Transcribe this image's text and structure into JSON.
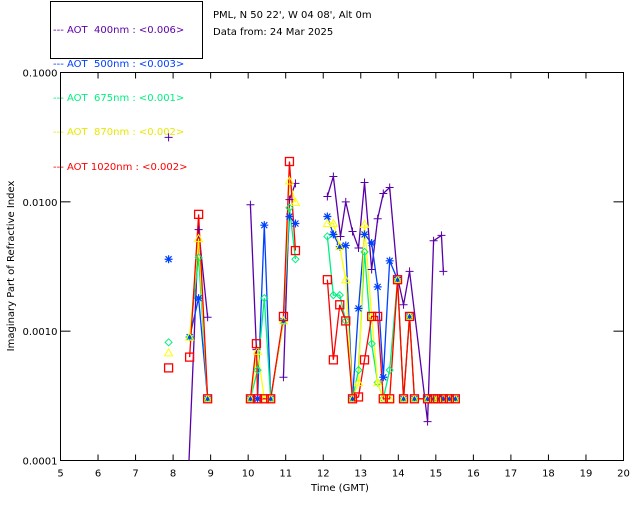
{
  "header": {
    "station": "PML, N 50 22', W 04 08', Alt 0m",
    "date_line": "Data from: 24 Mar 2025"
  },
  "chart_data": {
    "type": "line",
    "xlabel": "Time (GMT)",
    "ylabel": "Imaginary Part of Refractive Index",
    "xlim": [
      5,
      20
    ],
    "ylim": [
      0.0001,
      0.1
    ],
    "yscale": "log",
    "xticks": [
      "5",
      "6",
      "7",
      "8",
      "9",
      "10",
      "11",
      "12",
      "13",
      "14",
      "15",
      "16",
      "17",
      "18",
      "19",
      "20"
    ],
    "yticks": [
      "0.1000",
      "0.0100",
      "0.0010",
      "0.0001"
    ],
    "grid": false,
    "legend_position": "top-left, outside plot",
    "series": [
      {
        "name": "AOT  400nm : <0.006>",
        "color": "#5a00a8",
        "marker": "plus",
        "x": [
          7.88,
          8.41,
          8.68,
          8.92,
          10.06,
          10.22,
          10.94,
          11.1,
          11.26,
          12.11,
          12.27,
          12.46,
          12.6,
          12.78,
          12.94,
          13.1,
          13.29,
          13.45,
          13.6,
          13.77,
          13.98,
          14.14,
          14.3,
          14.78,
          14.94,
          15.15,
          15.2
        ],
        "y": [
          0.0315,
          8e-05,
          0.0061,
          0.00128,
          0.0095,
          0.00072,
          0.00044,
          0.0104,
          0.0139,
          0.011,
          0.0157,
          0.0054,
          0.01,
          0.0059,
          0.0044,
          0.0141,
          0.003,
          0.0074,
          0.0116,
          0.0129,
          0.0026,
          0.0016,
          0.0029,
          0.0002,
          0.005,
          0.0055,
          0.0029
        ]
      },
      {
        "name": "AOT  500nm : <0.003>",
        "color": "#0040ff",
        "marker": "asterisk",
        "x": [
          7.88,
          8.44,
          8.68,
          8.92,
          10.06,
          10.25,
          10.43,
          10.6,
          10.94,
          11.1,
          11.26,
          12.11,
          12.27,
          12.44,
          12.6,
          12.78,
          12.94,
          13.1,
          13.29,
          13.45,
          13.6,
          13.77,
          13.98,
          14.14,
          14.3,
          14.43,
          14.78,
          14.94,
          15.05,
          15.2,
          15.36,
          15.52
        ],
        "y": [
          0.0036,
          0.0009,
          0.0018,
          0.0003,
          0.0003,
          0.0003,
          0.0066,
          0.0003,
          0.0012,
          0.0077,
          0.0068,
          0.0077,
          0.0056,
          0.0045,
          0.0046,
          0.0003,
          0.0015,
          0.0056,
          0.0048,
          0.0022,
          0.00044,
          0.0035,
          0.0025,
          0.0003,
          0.0013,
          0.0003,
          0.0003,
          0.0003,
          0.0003,
          0.0003,
          0.0003,
          0.0003
        ]
      },
      {
        "name": "AOT  675nm : <0.001>",
        "color": "#00f080",
        "marker": "diamond",
        "x": [
          7.88,
          8.44,
          8.68,
          8.92,
          10.06,
          10.25,
          10.43,
          10.6,
          10.94,
          11.1,
          11.26,
          12.11,
          12.27,
          12.44,
          12.6,
          12.78,
          12.94,
          13.1,
          13.29,
          13.45,
          13.6,
          13.77,
          13.98,
          14.14,
          14.3,
          14.43,
          14.78,
          14.94,
          15.05,
          15.2,
          15.36,
          15.52
        ],
        "y": [
          0.00082,
          0.0009,
          0.0037,
          0.0003,
          0.0003,
          0.0005,
          0.0018,
          0.0003,
          0.0012,
          0.009,
          0.0036,
          0.0054,
          0.0019,
          0.0019,
          0.0012,
          0.0003,
          0.0005,
          0.0041,
          0.0008,
          0.0004,
          0.0003,
          0.0005,
          0.0025,
          0.0003,
          0.0013,
          0.0003,
          0.0003,
          0.0003,
          0.0003,
          0.0003,
          0.0003,
          0.0003
        ]
      },
      {
        "name": "AOT  870nm : <0.002>",
        "color": "#ffff00",
        "marker": "triangle",
        "x": [
          7.88,
          8.44,
          8.68,
          8.92,
          10.06,
          10.25,
          10.43,
          10.6,
          10.94,
          11.1,
          11.26,
          12.11,
          12.27,
          12.44,
          12.6,
          12.78,
          12.94,
          13.1,
          13.29,
          13.45,
          13.6,
          13.77,
          13.98,
          14.14,
          14.3,
          14.43,
          14.78,
          14.94,
          15.05,
          15.2,
          15.36,
          15.52
        ],
        "y": [
          0.00068,
          0.0009,
          0.0052,
          0.0003,
          0.0003,
          0.0007,
          0.0003,
          0.0003,
          0.0012,
          0.0145,
          0.0099,
          0.0068,
          0.0068,
          0.0045,
          0.0025,
          0.0003,
          0.0004,
          0.0067,
          0.0013,
          0.0004,
          0.0003,
          0.0003,
          0.0025,
          0.0003,
          0.0013,
          0.0003,
          0.0003,
          0.0003,
          0.0003,
          0.0003,
          0.0003,
          0.0003
        ]
      },
      {
        "name": "AOT 1020nm : <0.002>",
        "color": "#ff0000",
        "marker": "square",
        "x": [
          7.88,
          8.44,
          8.68,
          8.92,
          10.06,
          10.22,
          10.25,
          10.43,
          10.6,
          10.94,
          11.1,
          11.26,
          12.11,
          12.27,
          12.44,
          12.6,
          12.78,
          12.94,
          13.1,
          13.29,
          13.45,
          13.6,
          13.77,
          13.98,
          14.14,
          14.3,
          14.43,
          14.78,
          14.94,
          15.05,
          15.2,
          15.36,
          15.52
        ],
        "y": [
          0.00052,
          0.00063,
          0.008,
          0.0003,
          0.0003,
          0.0008,
          0.0003,
          0.0003,
          0.0003,
          0.0013,
          0.0205,
          0.0042,
          0.0025,
          0.0006,
          0.0016,
          0.0012,
          0.0003,
          0.00031,
          0.0006,
          0.0013,
          0.0013,
          0.0003,
          0.0003,
          0.0025,
          0.0003,
          0.0013,
          0.0003,
          0.0003,
          0.0003,
          0.0003,
          0.0003,
          0.0003,
          0.0003
        ]
      }
    ]
  }
}
